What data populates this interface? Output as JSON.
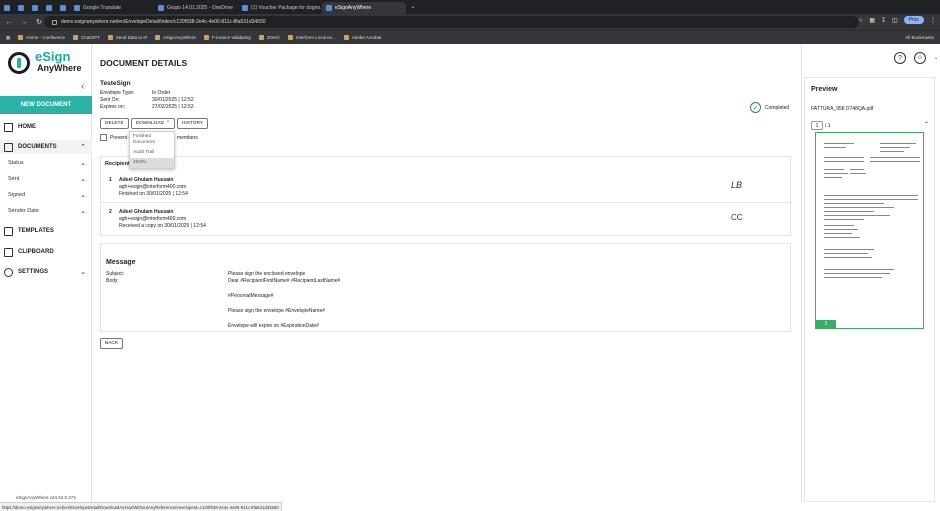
{
  "browser": {
    "tabs": [
      {
        "label": "",
        "icon": "chevron-down-icon",
        "pinned": true
      },
      {
        "label": "",
        "icon": "telegram-icon",
        "pinned": true
      },
      {
        "label": "",
        "icon": "telegram-icon",
        "pinned": true
      },
      {
        "label": "",
        "icon": "whatsapp-icon",
        "pinned": true
      },
      {
        "label": "",
        "icon": "chatgpt-icon",
        "pinned": true
      },
      {
        "label": "Google Translate",
        "icon": "translate-icon"
      },
      {
        "label": "Grupo 14.01.2025 - OneDrive",
        "icon": "onedrive-icon"
      },
      {
        "label": "(1) Voucher Package for dogno...",
        "icon": "page-icon"
      },
      {
        "label": "eSignAnyWhere",
        "icon": "esign-icon",
        "active": true
      }
    ],
    "url": "demo.esignanywhere.net/en/EnvelopeDetail/Index/c120f938-2e4c-4e00-811c-8fa531d34550",
    "profile_label": "Proc",
    "bookmarks": [
      "Home - Confluence",
      "ChatGPT",
      "Send Data to IF",
      "eSignAnyWhere",
      "F-invoice Validating",
      "ZOHO",
      "Interform Local en...",
      "Adobe Acrobat"
    ],
    "all_bookmarks": "All Bookmarks",
    "status_url": "https://demo.esignanywhere.net/en/EnvelopeDetail/DownloadAsJsonWithoutAnyReference/envelopeId=c120f938-2e4c-4e00-811c-8fa531d34550"
  },
  "sidebar": {
    "logo_word1": "eSign",
    "logo_word2": "AnyWhere",
    "new_document": "NEW DOCUMENT",
    "home": "HOME",
    "documents": "DOCUMENTS",
    "sub": [
      "Status",
      "Sent",
      "Signed",
      "Sender Date"
    ],
    "templates": "TEMPLATES",
    "clipboard": "CLIPBOARD",
    "settings": "SETTINGS",
    "version": "eSignAnyWhere v24.52.0.274"
  },
  "main": {
    "title": "DOCUMENT DETAILS",
    "envelope_name": "TesteSign",
    "meta": [
      {
        "k": "Envelope Type:",
        "v": "In Order"
      },
      {
        "k": "Sent On:",
        "v": "30/01/2025 | 12:52"
      },
      {
        "k": "Expires on:",
        "v": "27/02/2025 | 12:52"
      }
    ],
    "status": "Completed",
    "buttons": {
      "delete": "DELETE",
      "download": "DOWNLOAD",
      "history": "HISTORY",
      "back": "BACK"
    },
    "download_options": [
      "Finished Document",
      "Audit Trail",
      "JSON"
    ],
    "prevent_label": "Prevent c",
    "prevent_suffix": "members",
    "recipients_header": "Recipient",
    "recipients": [
      {
        "num": "1",
        "name": "Adeel Ghulam Hussain",
        "email": "agh+esign@interform400.com",
        "status": "Finished on 30/01/2025 | 12:54",
        "icon": "signed-icon",
        "glyph": "LB"
      },
      {
        "num": "2",
        "name": "Adeel Ghulam Hussain",
        "email": "agh+esign@interform400.com",
        "status": "Received a copy on 30/01/2025 | 12:54",
        "icon": "cc-icon",
        "glyph": "CC"
      }
    ],
    "message": {
      "header": "Message",
      "subject_label": "Subject:",
      "body_label": "Body:",
      "subject": "Please sign the enclosed envelope",
      "body_lines": [
        "Dear #RecipientFirstName# #RecipientLastName#",
        "#PersonalMessage#",
        "Please sign the envelope #EnvelopeName#",
        "Envelope will expire on #ExpirationDate#"
      ]
    }
  },
  "preview": {
    "title": "Preview",
    "filename": "FATTURA_958 D748QA.pdf",
    "page_current": "1",
    "page_total": "/ 1",
    "thumb_page": "1"
  }
}
